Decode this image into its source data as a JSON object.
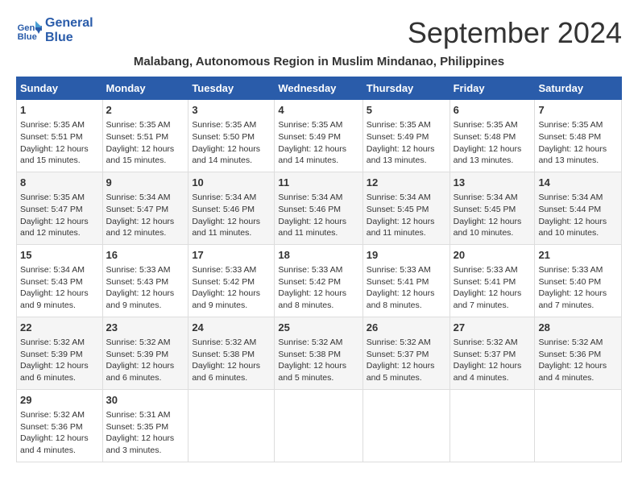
{
  "header": {
    "logo_line1": "General",
    "logo_line2": "Blue",
    "month_title": "September 2024",
    "location": "Malabang, Autonomous Region in Muslim Mindanao, Philippines"
  },
  "weekdays": [
    "Sunday",
    "Monday",
    "Tuesday",
    "Wednesday",
    "Thursday",
    "Friday",
    "Saturday"
  ],
  "weeks": [
    [
      {
        "day": "1",
        "sunrise": "5:35 AM",
        "sunset": "5:51 PM",
        "daylight": "12 hours and 15 minutes."
      },
      {
        "day": "2",
        "sunrise": "5:35 AM",
        "sunset": "5:51 PM",
        "daylight": "12 hours and 15 minutes."
      },
      {
        "day": "3",
        "sunrise": "5:35 AM",
        "sunset": "5:50 PM",
        "daylight": "12 hours and 14 minutes."
      },
      {
        "day": "4",
        "sunrise": "5:35 AM",
        "sunset": "5:49 PM",
        "daylight": "12 hours and 14 minutes."
      },
      {
        "day": "5",
        "sunrise": "5:35 AM",
        "sunset": "5:49 PM",
        "daylight": "12 hours and 13 minutes."
      },
      {
        "day": "6",
        "sunrise": "5:35 AM",
        "sunset": "5:48 PM",
        "daylight": "12 hours and 13 minutes."
      },
      {
        "day": "7",
        "sunrise": "5:35 AM",
        "sunset": "5:48 PM",
        "daylight": "12 hours and 13 minutes."
      }
    ],
    [
      {
        "day": "8",
        "sunrise": "5:35 AM",
        "sunset": "5:47 PM",
        "daylight": "12 hours and 12 minutes."
      },
      {
        "day": "9",
        "sunrise": "5:34 AM",
        "sunset": "5:47 PM",
        "daylight": "12 hours and 12 minutes."
      },
      {
        "day": "10",
        "sunrise": "5:34 AM",
        "sunset": "5:46 PM",
        "daylight": "12 hours and 11 minutes."
      },
      {
        "day": "11",
        "sunrise": "5:34 AM",
        "sunset": "5:46 PM",
        "daylight": "12 hours and 11 minutes."
      },
      {
        "day": "12",
        "sunrise": "5:34 AM",
        "sunset": "5:45 PM",
        "daylight": "12 hours and 11 minutes."
      },
      {
        "day": "13",
        "sunrise": "5:34 AM",
        "sunset": "5:45 PM",
        "daylight": "12 hours and 10 minutes."
      },
      {
        "day": "14",
        "sunrise": "5:34 AM",
        "sunset": "5:44 PM",
        "daylight": "12 hours and 10 minutes."
      }
    ],
    [
      {
        "day": "15",
        "sunrise": "5:34 AM",
        "sunset": "5:43 PM",
        "daylight": "12 hours and 9 minutes."
      },
      {
        "day": "16",
        "sunrise": "5:33 AM",
        "sunset": "5:43 PM",
        "daylight": "12 hours and 9 minutes."
      },
      {
        "day": "17",
        "sunrise": "5:33 AM",
        "sunset": "5:42 PM",
        "daylight": "12 hours and 9 minutes."
      },
      {
        "day": "18",
        "sunrise": "5:33 AM",
        "sunset": "5:42 PM",
        "daylight": "12 hours and 8 minutes."
      },
      {
        "day": "19",
        "sunrise": "5:33 AM",
        "sunset": "5:41 PM",
        "daylight": "12 hours and 8 minutes."
      },
      {
        "day": "20",
        "sunrise": "5:33 AM",
        "sunset": "5:41 PM",
        "daylight": "12 hours and 7 minutes."
      },
      {
        "day": "21",
        "sunrise": "5:33 AM",
        "sunset": "5:40 PM",
        "daylight": "12 hours and 7 minutes."
      }
    ],
    [
      {
        "day": "22",
        "sunrise": "5:32 AM",
        "sunset": "5:39 PM",
        "daylight": "12 hours and 6 minutes."
      },
      {
        "day": "23",
        "sunrise": "5:32 AM",
        "sunset": "5:39 PM",
        "daylight": "12 hours and 6 minutes."
      },
      {
        "day": "24",
        "sunrise": "5:32 AM",
        "sunset": "5:38 PM",
        "daylight": "12 hours and 6 minutes."
      },
      {
        "day": "25",
        "sunrise": "5:32 AM",
        "sunset": "5:38 PM",
        "daylight": "12 hours and 5 minutes."
      },
      {
        "day": "26",
        "sunrise": "5:32 AM",
        "sunset": "5:37 PM",
        "daylight": "12 hours and 5 minutes."
      },
      {
        "day": "27",
        "sunrise": "5:32 AM",
        "sunset": "5:37 PM",
        "daylight": "12 hours and 4 minutes."
      },
      {
        "day": "28",
        "sunrise": "5:32 AM",
        "sunset": "5:36 PM",
        "daylight": "12 hours and 4 minutes."
      }
    ],
    [
      {
        "day": "29",
        "sunrise": "5:32 AM",
        "sunset": "5:36 PM",
        "daylight": "12 hours and 4 minutes."
      },
      {
        "day": "30",
        "sunrise": "5:31 AM",
        "sunset": "5:35 PM",
        "daylight": "12 hours and 3 minutes."
      },
      null,
      null,
      null,
      null,
      null
    ]
  ]
}
